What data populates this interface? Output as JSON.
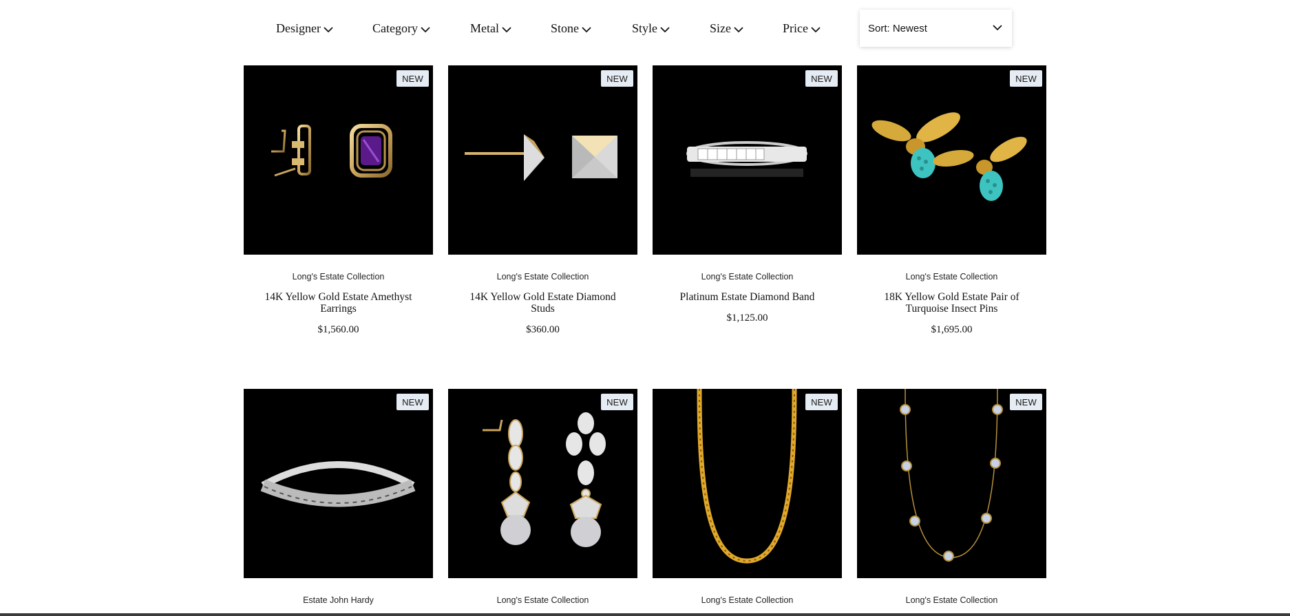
{
  "filters": {
    "designer": "Designer",
    "category": "Category",
    "metal": "Metal",
    "stone": "Stone",
    "style": "Style",
    "size": "Size",
    "price": "Price"
  },
  "sort": {
    "label": "Sort: Newest"
  },
  "products": [
    {
      "badge": "NEW",
      "designer": "Long's Estate Collection",
      "title": "14K Yellow Gold Estate Amethyst Earrings",
      "price": "$1,560.00",
      "image": "amethyst-earrings"
    },
    {
      "badge": "NEW",
      "designer": "Long's Estate Collection",
      "title": "14K Yellow Gold Estate Diamond Studs",
      "price": "$360.00",
      "image": "diamond-studs"
    },
    {
      "badge": "NEW",
      "designer": "Long's Estate Collection",
      "title": "Platinum Estate Diamond Band",
      "price": "$1,125.00",
      "image": "diamond-band"
    },
    {
      "badge": "NEW",
      "designer": "Long's Estate Collection",
      "title": "18K Yellow Gold Estate Pair of Turquoise Insect Pins",
      "price": "$1,695.00",
      "image": "turquoise-insect-pins"
    },
    {
      "badge": "NEW",
      "designer": "Estate John Hardy",
      "image": "silver-cuff-bracelet"
    },
    {
      "badge": "NEW",
      "designer": "Long's Estate Collection",
      "image": "pearl-drop-earrings"
    },
    {
      "badge": "NEW",
      "designer": "Long's Estate Collection",
      "image": "gold-rope-chain"
    },
    {
      "badge": "NEW",
      "designer": "Long's Estate Collection",
      "image": "moonstone-station-necklace"
    }
  ]
}
